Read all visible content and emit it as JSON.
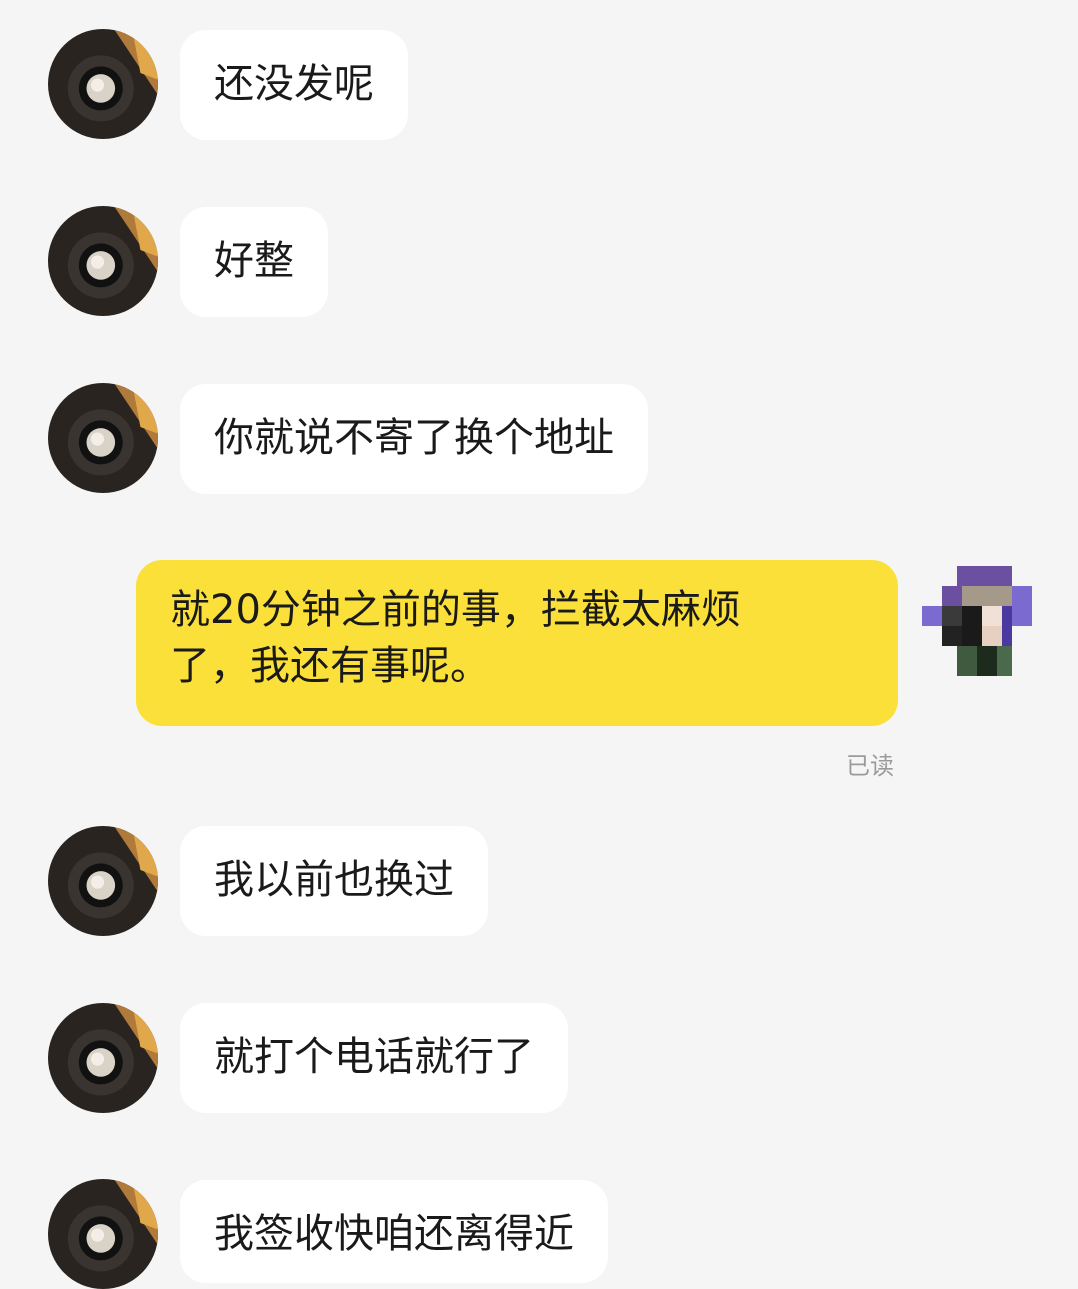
{
  "messages": [
    {
      "side": "left",
      "text": "还没发呢"
    },
    {
      "side": "left",
      "text": "好整"
    },
    {
      "side": "left",
      "text": "你就说不寄了换个地址"
    },
    {
      "side": "right",
      "line1": "就20分钟之前的事，拦截太麻烦",
      "line2": "了，我还有事呢。",
      "status": "已读"
    },
    {
      "side": "left",
      "text": "我以前也换过"
    },
    {
      "side": "left",
      "text": "就打个电话就行了"
    },
    {
      "side": "left",
      "text": "我签收快咱还离得近"
    }
  ],
  "colors": {
    "background": "#f5f5f5",
    "incoming_bubble": "#ffffff",
    "outgoing_bubble": "#fbe03a",
    "read_status": "#9b9b9b"
  },
  "icons": {
    "contact_avatar": "contact-avatar-lens",
    "self_avatar": "self-avatar-pixelated"
  }
}
